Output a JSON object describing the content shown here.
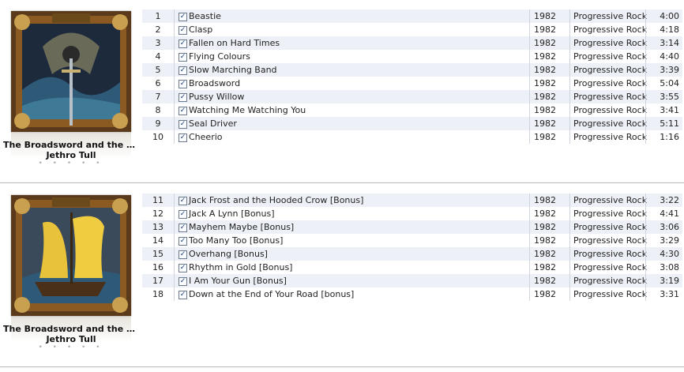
{
  "albums": [
    {
      "title": "The Broadsword and the Be...",
      "artist": "Jethro Tull",
      "rating": "• • • • •",
      "tracks": [
        {
          "num": "1",
          "name": "Beastie",
          "year": "1982",
          "genre": "Progressive Rock",
          "time": "4:00"
        },
        {
          "num": "2",
          "name": "Clasp",
          "year": "1982",
          "genre": "Progressive Rock",
          "time": "4:18"
        },
        {
          "num": "3",
          "name": "Fallen on Hard Times",
          "year": "1982",
          "genre": "Progressive Rock",
          "time": "3:14"
        },
        {
          "num": "4",
          "name": "Flying Colours",
          "year": "1982",
          "genre": "Progressive Rock",
          "time": "4:40"
        },
        {
          "num": "5",
          "name": "Slow Marching Band",
          "year": "1982",
          "genre": "Progressive Rock",
          "time": "3:39"
        },
        {
          "num": "6",
          "name": "Broadsword",
          "year": "1982",
          "genre": "Progressive Rock",
          "time": "5:04"
        },
        {
          "num": "7",
          "name": "Pussy Willow",
          "year": "1982",
          "genre": "Progressive Rock",
          "time": "3:55"
        },
        {
          "num": "8",
          "name": "Watching Me Watching You",
          "year": "1982",
          "genre": "Progressive Rock",
          "time": "3:41"
        },
        {
          "num": "9",
          "name": "Seal Driver",
          "year": "1982",
          "genre": "Progressive Rock",
          "time": "5:11"
        },
        {
          "num": "10",
          "name": "Cheerio",
          "year": "1982",
          "genre": "Progressive Rock",
          "time": "1:16"
        }
      ]
    },
    {
      "title": "The Broadsword and the Be...",
      "artist": "Jethro Tull",
      "rating": "• • • • •",
      "tracks": [
        {
          "num": "11",
          "name": "Jack Frost and the Hooded Crow [Bonus]",
          "year": "1982",
          "genre": "Progressive Rock",
          "time": "3:22"
        },
        {
          "num": "12",
          "name": "Jack A Lynn [Bonus]",
          "year": "1982",
          "genre": "Progressive Rock",
          "time": "4:41"
        },
        {
          "num": "13",
          "name": "Mayhem Maybe [Bonus]",
          "year": "1982",
          "genre": "Progressive Rock",
          "time": "3:06"
        },
        {
          "num": "14",
          "name": "Too Many Too [Bonus]",
          "year": "1982",
          "genre": "Progressive Rock",
          "time": "3:29"
        },
        {
          "num": "15",
          "name": "Overhang [Bonus]",
          "year": "1982",
          "genre": "Progressive Rock",
          "time": "4:30"
        },
        {
          "num": "16",
          "name": "Rhythm in Gold [Bonus]",
          "year": "1982",
          "genre": "Progressive Rock",
          "time": "3:08"
        },
        {
          "num": "17",
          "name": "I Am Your Gun [Bonus]",
          "year": "1982",
          "genre": "Progressive Rock",
          "time": "3:19"
        },
        {
          "num": "18",
          "name": "Down at the End of Your Road [bonus]",
          "year": "1982",
          "genre": "Progressive Rock",
          "time": "3:31"
        }
      ]
    }
  ],
  "checkbox_glyph": "✓",
  "colors": {
    "row_alt": "#edf1f7",
    "separator": "#b8b8b8",
    "column_rule": "#cfd5dd"
  }
}
